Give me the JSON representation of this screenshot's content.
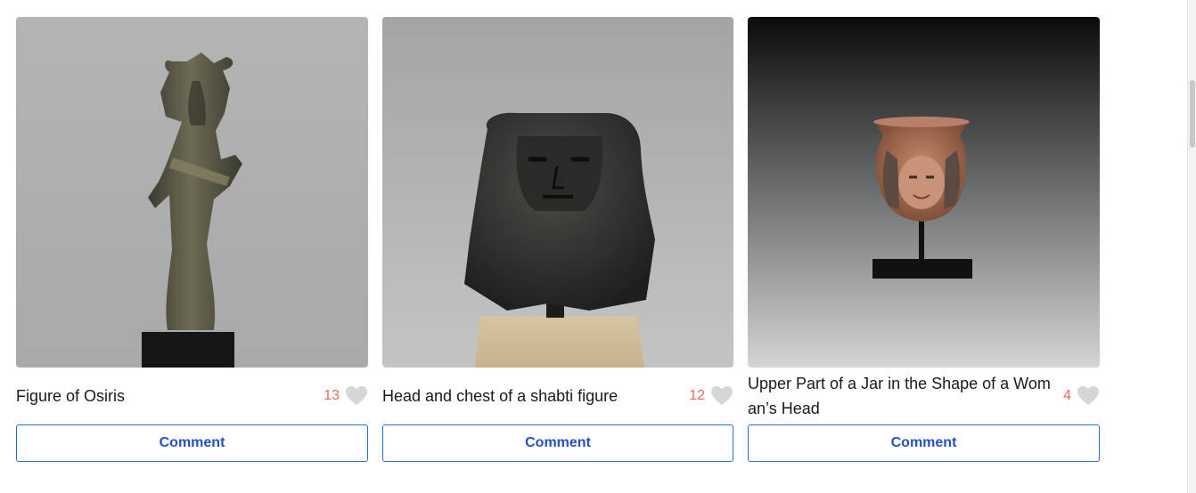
{
  "cards": [
    {
      "title": "Figure of Osiris",
      "likes": "13",
      "comment_label": "Comment",
      "image_subject": "bronze Osiris figurine on black base"
    },
    {
      "title": "Head and chest of a shabti figure",
      "likes": "12",
      "comment_label": "Comment",
      "image_subject": "dark stone shabti head on wooden mount"
    },
    {
      "title": "Upper Part of a Jar in the Shape of a Woman’s Head",
      "likes": "4",
      "comment_label": "Comment",
      "image_subject": "terracotta jar fragment with woman's face on black stand"
    }
  ],
  "colors": {
    "accent": "#2450c4",
    "like_count": "#e86a5c",
    "heart": "#d6d6d6"
  },
  "icons": {
    "like": "heart-icon"
  }
}
